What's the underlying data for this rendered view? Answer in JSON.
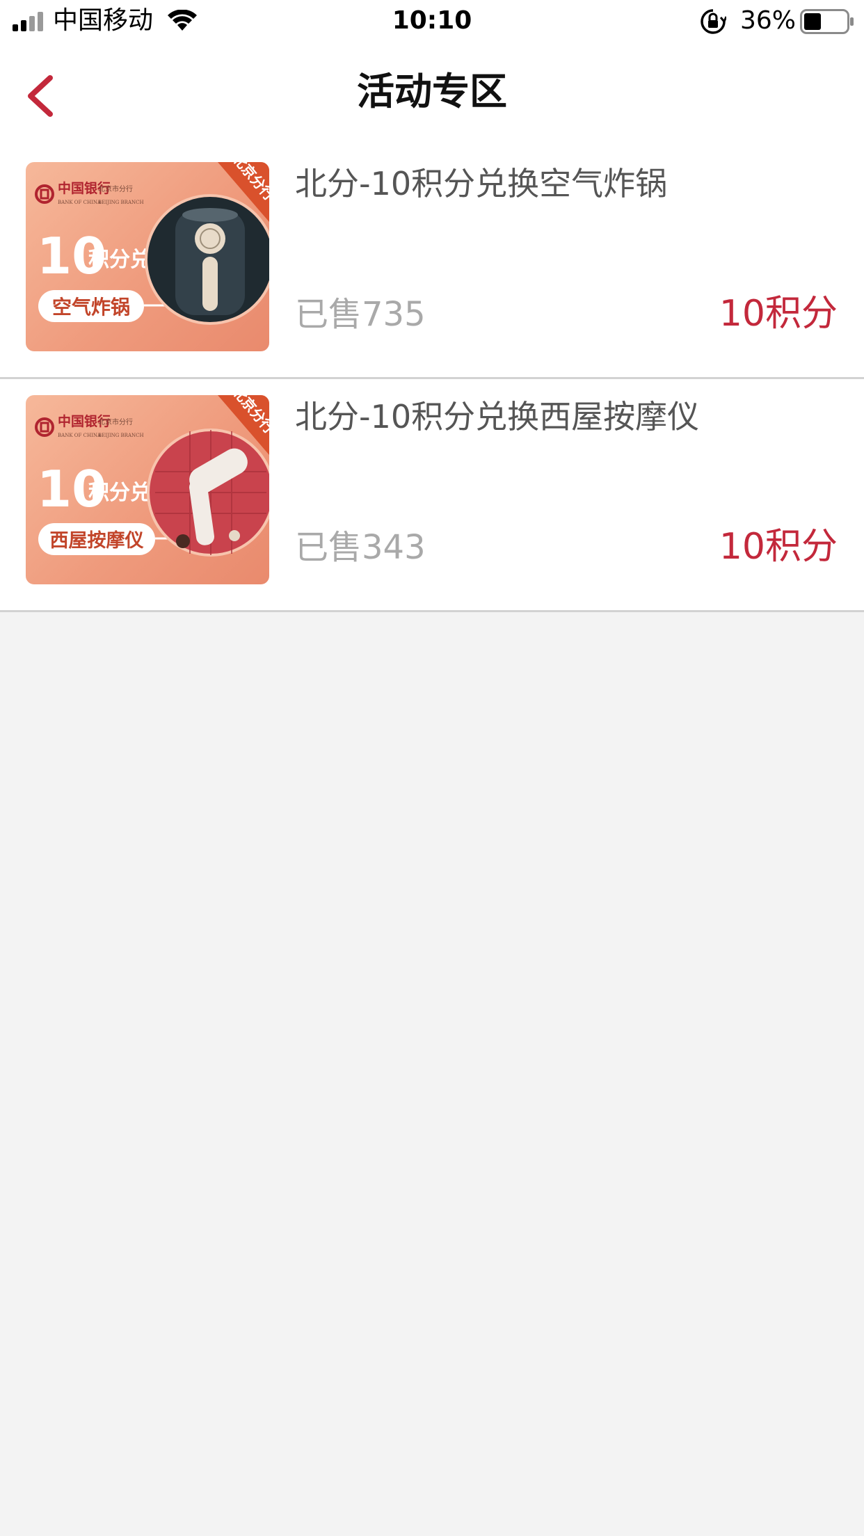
{
  "status_bar": {
    "carrier": "中国移动",
    "time": "10:10",
    "battery_percent": "36%",
    "battery_level": 0.36
  },
  "nav": {
    "title": "活动专区",
    "back_icon": "chevron-left-icon",
    "accent_color": "#c3283b"
  },
  "items": [
    {
      "title": "北分-10积分兑换空气炸锅",
      "sold": "已售735",
      "price": "10积分",
      "banner": {
        "bank_name": "中国银行",
        "bank_en": "BANK OF CHINA",
        "branch": "北京市分行",
        "branch_en": "BEIJING BRANCH",
        "headline_number": "10",
        "headline_text": "积分兑",
        "product_label": "空气炸锅",
        "corner_tag": "北京分行"
      }
    },
    {
      "title": "北分-10积分兑换西屋按摩仪",
      "sold": "已售343",
      "price": "10积分",
      "banner": {
        "bank_name": "中国银行",
        "bank_en": "BANK OF CHINA",
        "branch": "北京市分行",
        "branch_en": "BEIJING BRANCH",
        "headline_number": "10",
        "headline_text": "积分兑",
        "product_label": "西屋按摩仪",
        "corner_tag": "北京分行"
      }
    }
  ]
}
